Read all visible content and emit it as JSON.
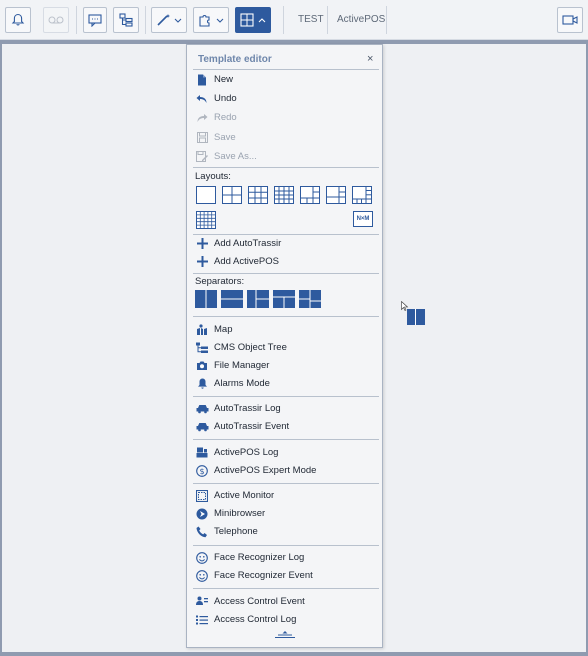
{
  "toolbar": {
    "tab_test": "TEST",
    "tab_activepos": "ActivePOS",
    "buttons": [
      "bell-icon",
      "tape-icon",
      "chat-icon",
      "tree-icon",
      "magic-wand-icon",
      "puzzle-icon",
      "layout-editor-icon",
      "camera-icon"
    ]
  },
  "menu": {
    "title": "Template editor",
    "close": "×",
    "file_items": [
      {
        "label": "New",
        "icon": "new-file-icon",
        "enabled": true
      },
      {
        "label": "Undo",
        "icon": "undo-icon",
        "enabled": true
      },
      {
        "label": "Redo",
        "icon": "redo-icon",
        "enabled": false
      },
      {
        "label": "Save",
        "icon": "save-icon",
        "enabled": false
      },
      {
        "label": "Save As...",
        "icon": "save-as-icon",
        "enabled": false
      }
    ],
    "layouts_label": "Layouts:",
    "nm_label": "N×M",
    "add_items": [
      {
        "label": "Add AutoTrassir",
        "icon": "plus-icon"
      },
      {
        "label": "Add ActivePOS",
        "icon": "plus-icon"
      }
    ],
    "separators_label": "Separators:",
    "tool_items": [
      {
        "label": "Map",
        "icon": "map-icon"
      },
      {
        "label": "CMS Object Tree",
        "icon": "object-tree-icon"
      },
      {
        "label": "File Manager",
        "icon": "camera-icon"
      },
      {
        "label": "Alarms Mode",
        "icon": "bell-icon"
      }
    ],
    "autotrassir_items": [
      {
        "label": "AutoTrassir Log",
        "icon": "car-icon"
      },
      {
        "label": "AutoTrassir Event",
        "icon": "car-icon"
      }
    ],
    "activepos_items": [
      {
        "label": "ActivePOS Log",
        "icon": "pos-icon"
      },
      {
        "label": "ActivePOS Expert Mode",
        "icon": "dollar-icon"
      }
    ],
    "misc_items": [
      {
        "label": "Active Monitor",
        "icon": "monitor-icon"
      },
      {
        "label": "Minibrowser",
        "icon": "compass-icon"
      },
      {
        "label": "Telephone",
        "icon": "phone-icon"
      }
    ],
    "face_items": [
      {
        "label": "Face Recognizer Log",
        "icon": "face-icon"
      },
      {
        "label": "Face Recognizer Event",
        "icon": "face-icon"
      }
    ],
    "access_items": [
      {
        "label": "Access Control Event",
        "icon": "access-event-icon"
      },
      {
        "label": "Access Control Log",
        "icon": "list-icon"
      }
    ]
  },
  "colors": {
    "accent": "#2e5a9e",
    "title": "#6f87ab",
    "text": "#222a36",
    "disabled": "#9aa3b0"
  }
}
